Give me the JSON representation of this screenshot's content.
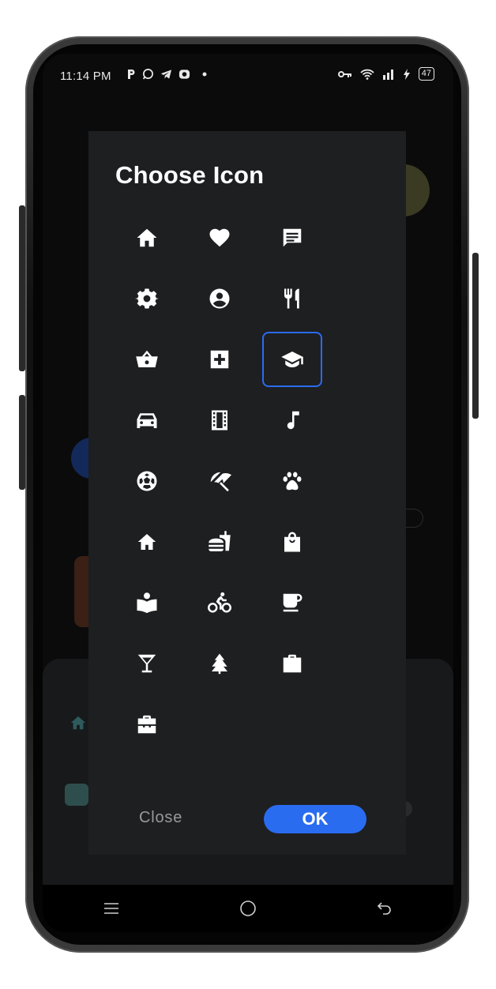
{
  "status_bar": {
    "time": "11:14 PM",
    "notification_icons": [
      "parking-icon",
      "whatsapp-icon",
      "telegram-icon",
      "photos-icon",
      "dot-icon"
    ],
    "right_icons": [
      "key-icon",
      "wifi-icon",
      "signal-icon",
      "charging-icon"
    ],
    "battery": "47"
  },
  "dialog": {
    "title": "Choose Icon",
    "icons": [
      "home-icon",
      "heart-icon",
      "chat-icon",
      "gear-icon",
      "account-icon",
      "restaurant-icon",
      "basket-icon",
      "medical-icon",
      "graduation-cap-icon",
      "car-icon",
      "film-icon",
      "music-note-icon",
      "soccer-ball-icon",
      "beach-umbrella-icon",
      "paw-icon",
      "house-icon",
      "fast-food-icon",
      "shopping-bag-icon",
      "reading-icon",
      "bicycle-icon",
      "coffee-cup-icon",
      "cocktail-icon",
      "tree-icon",
      "briefcase-icon",
      "toolbox-icon"
    ],
    "selected_icon": "graduation-cap-icon",
    "close_label": "Close",
    "ok_label": "OK"
  },
  "navbar": {
    "items": [
      "menu-icon",
      "home-circle-icon",
      "back-icon"
    ]
  },
  "colors": {
    "accent": "#2a6cf0",
    "dialog_bg": "#1e1f21",
    "screen_bg": "#0b0b0c"
  }
}
